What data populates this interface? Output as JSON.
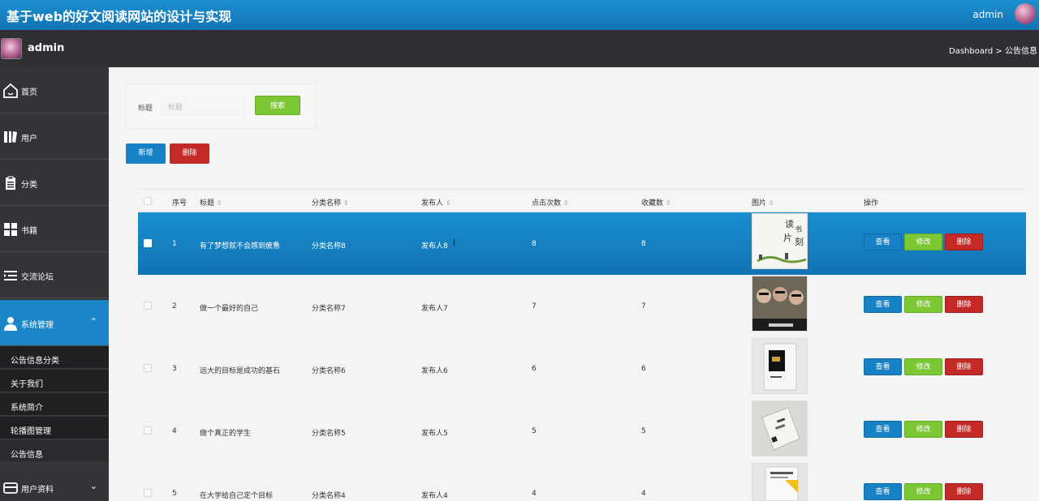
{
  "header": {
    "title": "基于web的好文阅读网站的设计与实现",
    "user": "admin"
  },
  "subheader": {
    "name": "admin",
    "breadcrumb": "Dashboard > 公告信息"
  },
  "sidebar": {
    "items": [
      {
        "label": "首页",
        "icon": "home-icon"
      },
      {
        "label": "用户",
        "icon": "user-book-icon"
      },
      {
        "label": "分类",
        "icon": "clipboard-icon"
      },
      {
        "label": "书籍",
        "icon": "grid-icon"
      },
      {
        "label": "交流论坛",
        "icon": "list-indent-icon"
      },
      {
        "label": "系统管理",
        "icon": "person-icon"
      },
      {
        "label": "用户资料",
        "icon": "card-icon"
      }
    ],
    "submenu": [
      "公告信息分类",
      "关于我们",
      "系统简介",
      "轮播图管理",
      "公告信息"
    ]
  },
  "search": {
    "label": "标题",
    "placeholder": "标题",
    "button": "搜索"
  },
  "actions": {
    "add": "新增",
    "delete": "删除"
  },
  "table": {
    "headers": [
      "序号",
      "标题",
      "分类名称",
      "发布人",
      "点击次数",
      "收藏数",
      "图片",
      "操作"
    ],
    "rows": [
      {
        "no": "1",
        "title": "有了梦想就不会感到疲惫",
        "category": "分类名称8",
        "publisher": "发布人8",
        "clicks": "8",
        "favorites": "8"
      },
      {
        "no": "2",
        "title": "做一个最好的自己",
        "category": "分类名称7",
        "publisher": "发布人7",
        "clicks": "7",
        "favorites": "7"
      },
      {
        "no": "3",
        "title": "远大的目标是成功的基石",
        "category": "分类名称6",
        "publisher": "发布人6",
        "clicks": "6",
        "favorites": "6"
      },
      {
        "no": "4",
        "title": "做个真正的学生",
        "category": "分类名称5",
        "publisher": "发布人5",
        "clicks": "5",
        "favorites": "5"
      },
      {
        "no": "5",
        "title": "在大学给自己定个目标",
        "category": "分类名称4",
        "publisher": "发布人4",
        "clicks": "4",
        "favorites": "4"
      }
    ],
    "row_buttons": {
      "view": "查看",
      "edit": "修改",
      "delete": "删除"
    }
  },
  "colors": {
    "primary": "#1681c4",
    "success": "#7cc734",
    "danger": "#c12a27",
    "sidebar": "#333437"
  }
}
